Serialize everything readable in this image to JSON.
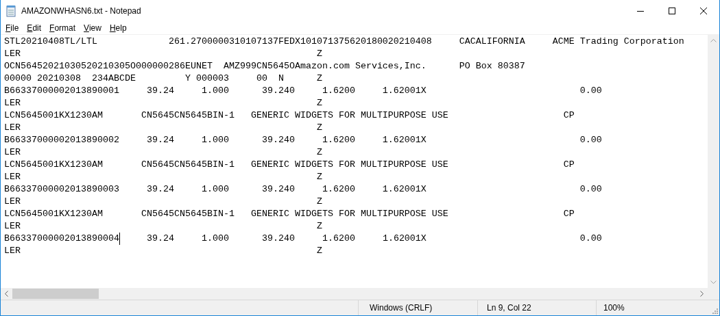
{
  "window": {
    "title": "AMAZONWHASN6.txt - Notepad"
  },
  "menu": [
    "File",
    "Edit",
    "Format",
    "View",
    "Help"
  ],
  "lines": [
    {
      "text": "STL20210408TL/LTL             261.2700000310107137FEDX101071375620180020210408     CACALIFORNIA     ACME Trading Corporation",
      "caret": false
    },
    {
      "text": "LER                                                      Z",
      "caret": false
    },
    {
      "text": "OCN56452021030520210305O000000286EUNET  AMZ999CN5645OAmazon.com Services,Inc.      PO Box 80387",
      "caret": false
    },
    {
      "text": "00000 20210308  234ABCDE         Y 000003     00  N      Z",
      "caret": false
    },
    {
      "text": "B66337000002013890001     39.24     1.000      39.240     1.6200     1.62001X                            0.00",
      "caret": false
    },
    {
      "text": "LER                                                      Z",
      "caret": false
    },
    {
      "text": "LCN5645001KX1230AM       CN5645CN5645BIN-1   GENERIC WIDGETS FOR MULTIPURPOSE USE                     CP",
      "caret": false
    },
    {
      "text": "LER                                                      Z",
      "caret": false
    },
    {
      "text": "B66337000002013890002     39.24     1.000      39.240     1.6200     1.62001X                            0.00",
      "caret": false
    },
    {
      "text": "LER                                                      Z",
      "caret": false
    },
    {
      "text": "LCN5645001KX1230AM       CN5645CN5645BIN-1   GENERIC WIDGETS FOR MULTIPURPOSE USE                     CP",
      "caret": false
    },
    {
      "text": "LER                                                      Z",
      "caret": false
    },
    {
      "text": "B66337000002013890003     39.24     1.000      39.240     1.6200     1.62001X                            0.00",
      "caret": false
    },
    {
      "text": "LER                                                      Z",
      "caret": false
    },
    {
      "text": "LCN5645001KX1230AM       CN5645CN5645BIN-1   GENERIC WIDGETS FOR MULTIPURPOSE USE                     CP",
      "caret": false
    },
    {
      "text": "LER                                                      Z",
      "caret": false
    },
    {
      "text": "B66337000002013890004",
      "caret": true,
      "after": "     39.24     1.000      39.240     1.6200     1.62001X                            0.00"
    },
    {
      "text": "LER                                                      Z",
      "caret": false
    }
  ],
  "status_bar": {
    "line_ending": "Windows (CRLF)",
    "position": "Ln 9, Col 22",
    "zoom": "100%"
  }
}
